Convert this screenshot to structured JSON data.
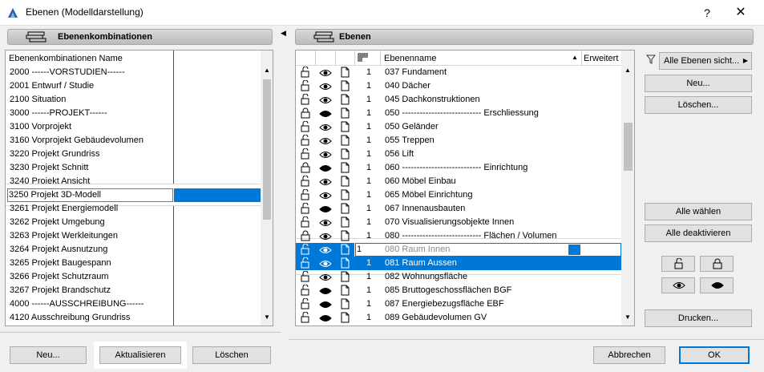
{
  "window": {
    "title": "Ebenen (Modelldarstellung)",
    "help": "?",
    "close": "✕"
  },
  "left_panel": {
    "header": "Ebenenkombinationen",
    "column_header": "Ebenenkombinationen Name",
    "items": [
      "2000 ------VORSTUDIEN------",
      "2001 Entwurf / Studie",
      "2100 Situation",
      "3000 ------PROJEKT------",
      "3100 Vorprojekt",
      "3160 Vorprojekt Gebäudevolumen",
      "3220 Projekt Grundriss",
      "3230 Projekt Schnitt",
      "3240 Projekt Ansicht",
      "3250 Projekt 3D-Modell",
      "3261 Projekt Energiemodell",
      "3262 Projekt Umgebung",
      "3263 Projekt Werkleitungen",
      "3264 Projekt Ausnutzung",
      "3265 Projekt Baugespann",
      "3266 Projekt Schutzraum",
      "3267 Projekt Brandschutz",
      "4000 ------AUSSCHREIBUNG------",
      "4120 Ausschreibung Grundriss"
    ],
    "selected_index": 9,
    "buttons": {
      "new": "Neu...",
      "update": "Aktualisieren",
      "delete": "Löschen"
    }
  },
  "right_panel": {
    "header": "Ebenen",
    "columns": {
      "name": "Ebenenname",
      "extended": "Erweitert"
    },
    "layers": [
      {
        "lock": "open",
        "visible": true,
        "num": "1",
        "name": "037 Fundament"
      },
      {
        "lock": "open",
        "visible": true,
        "num": "1",
        "name": "040 Dächer"
      },
      {
        "lock": "open",
        "visible": true,
        "num": "1",
        "name": "045 Dachkonstruktionen"
      },
      {
        "lock": "closed",
        "visible": false,
        "num": "1",
        "name": "050 --------------------------- Erschliessung"
      },
      {
        "lock": "open",
        "visible": true,
        "num": "1",
        "name": "050 Geländer"
      },
      {
        "lock": "open",
        "visible": true,
        "num": "1",
        "name": "055 Treppen"
      },
      {
        "lock": "open",
        "visible": true,
        "num": "1",
        "name": "056 Lift"
      },
      {
        "lock": "closed",
        "visible": false,
        "num": "1",
        "name": "060 --------------------------- Einrichtung"
      },
      {
        "lock": "open",
        "visible": true,
        "num": "1",
        "name": "060 Möbel Einbau"
      },
      {
        "lock": "open",
        "visible": true,
        "num": "1",
        "name": "065 Möbel Einrichtung"
      },
      {
        "lock": "open",
        "visible": false,
        "num": "1",
        "name": "067 Innenausbauten"
      },
      {
        "lock": "open",
        "visible": true,
        "num": "1",
        "name": "070 Visualisierungsobjekte Innen"
      },
      {
        "lock": "closed",
        "visible": true,
        "num": "1",
        "name": "080 --------------------------- Flächen / Volumen"
      },
      {
        "lock": "open",
        "visible": true,
        "num": "1",
        "name": "080 Raum Innen",
        "editing": true
      },
      {
        "lock": "open",
        "visible": true,
        "num": "1",
        "name": "081 Raum Aussen",
        "selected": true
      },
      {
        "lock": "open",
        "visible": true,
        "num": "1",
        "name": "082 Wohnungsfläche"
      },
      {
        "lock": "open",
        "visible": false,
        "num": "1",
        "name": "085 Bruttogeschossflächen BGF"
      },
      {
        "lock": "open",
        "visible": false,
        "num": "1",
        "name": "087 Energiebezugsfläche EBF"
      },
      {
        "lock": "open",
        "visible": false,
        "num": "1",
        "name": "089 Gebäudevolumen GV"
      }
    ]
  },
  "side": {
    "filter_label": "Alle Ebenen sicht...",
    "new": "Neu...",
    "delete": "Löschen...",
    "select_all": "Alle wählen",
    "deselect_all": "Alle deaktivieren",
    "print": "Drucken..."
  },
  "footer": {
    "cancel": "Abbrechen",
    "ok": "OK"
  },
  "colors": {
    "selection": "#0078d7",
    "header_gradient_top": "#d8d8d8",
    "header_gradient_bottom": "#bcbcbc"
  }
}
